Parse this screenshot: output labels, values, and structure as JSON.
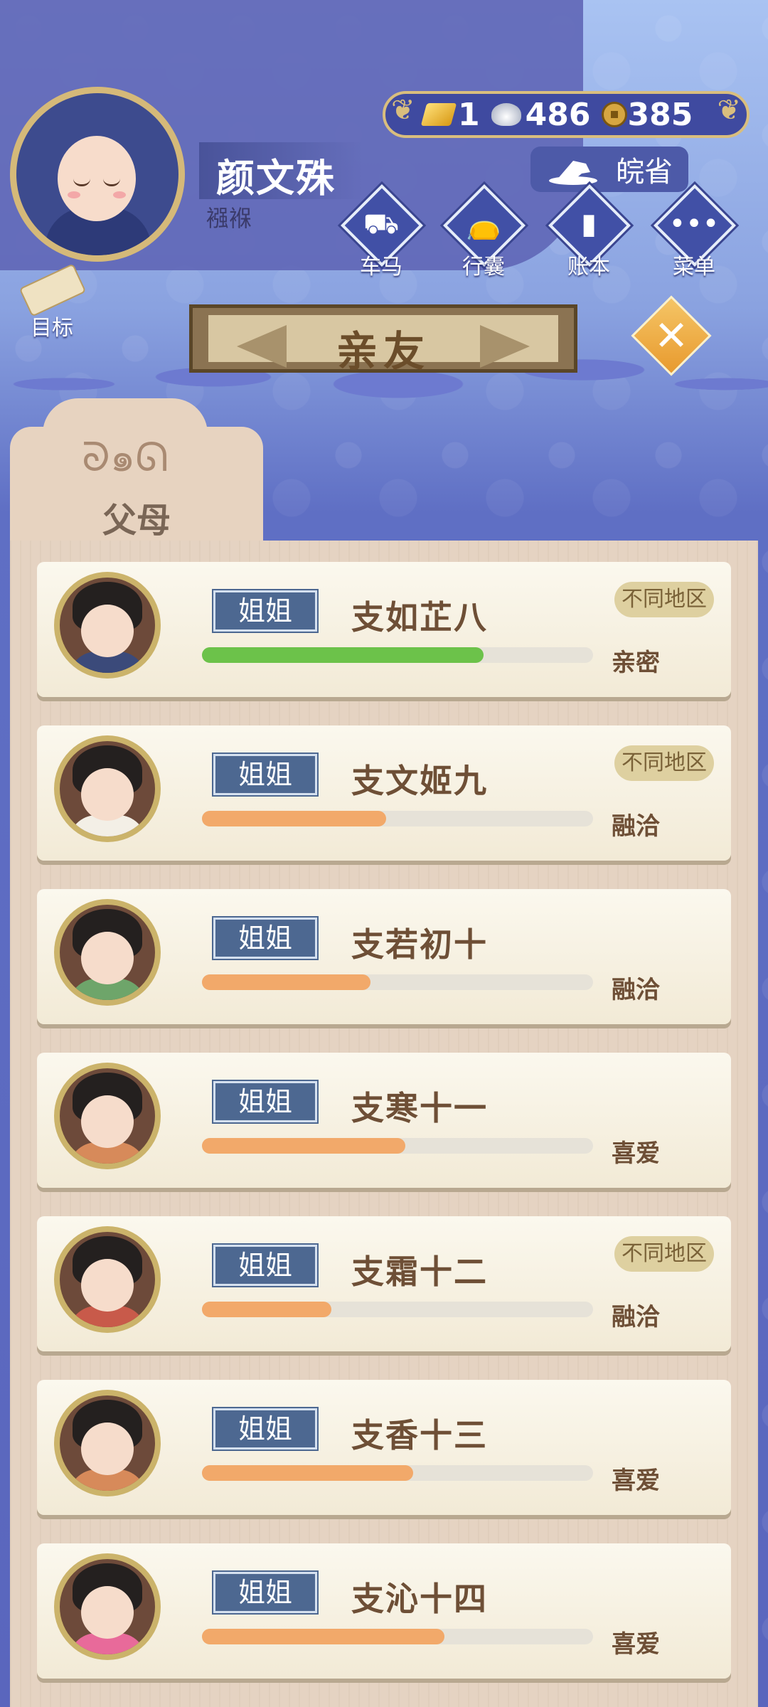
{
  "player": {
    "name": "颜文殊",
    "title": "襁褓"
  },
  "currency": {
    "gold": "1",
    "silver": "486",
    "copper": "385"
  },
  "region": {
    "label": "皖省"
  },
  "menu": [
    {
      "key": "cart",
      "label": "车马",
      "icon": "carriage-icon"
    },
    {
      "key": "bag",
      "label": "行囊",
      "icon": "bag-icon"
    },
    {
      "key": "ledger",
      "label": "账本",
      "icon": "ledger-icon"
    },
    {
      "key": "menu",
      "label": "菜单",
      "icon": "more-icon"
    }
  ],
  "target": {
    "label": "目标"
  },
  "page_title": "亲友",
  "tab": {
    "label": "父母"
  },
  "colors": {
    "bar_green": "#6cc24a",
    "bar_orange": "#f2a96a",
    "badge_blue": "#4d6891",
    "panel": "#e5d3c2"
  },
  "members": [
    {
      "relation": "姐姐",
      "name": "支如芷八",
      "status": "亲密",
      "tag": "不同地区",
      "progress": 0.72,
      "bar_color": "#6cc24a",
      "robe": "#3b4a7a"
    },
    {
      "relation": "姐姐",
      "name": "支文姬九",
      "status": "融洽",
      "tag": "不同地区",
      "progress": 0.47,
      "bar_color": "#f2a96a",
      "robe": "#f3efe6"
    },
    {
      "relation": "姐姐",
      "name": "支若初十",
      "status": "融洽",
      "tag": "",
      "progress": 0.43,
      "bar_color": "#f2a96a",
      "robe": "#6ea56a"
    },
    {
      "relation": "姐姐",
      "name": "支寒十一",
      "status": "喜爱",
      "tag": "",
      "progress": 0.52,
      "bar_color": "#f2a96a",
      "robe": "#d78a5a"
    },
    {
      "relation": "姐姐",
      "name": "支霜十二",
      "status": "融洽",
      "tag": "不同地区",
      "progress": 0.33,
      "bar_color": "#f2a96a",
      "robe": "#c85a4a"
    },
    {
      "relation": "姐姐",
      "name": "支香十三",
      "status": "喜爱",
      "tag": "",
      "progress": 0.54,
      "bar_color": "#f2a96a",
      "robe": "#d78a5a"
    },
    {
      "relation": "姐姐",
      "name": "支沁十四",
      "status": "喜爱",
      "tag": "",
      "progress": 0.62,
      "bar_color": "#f2a96a",
      "robe": "#e86a9a"
    }
  ]
}
